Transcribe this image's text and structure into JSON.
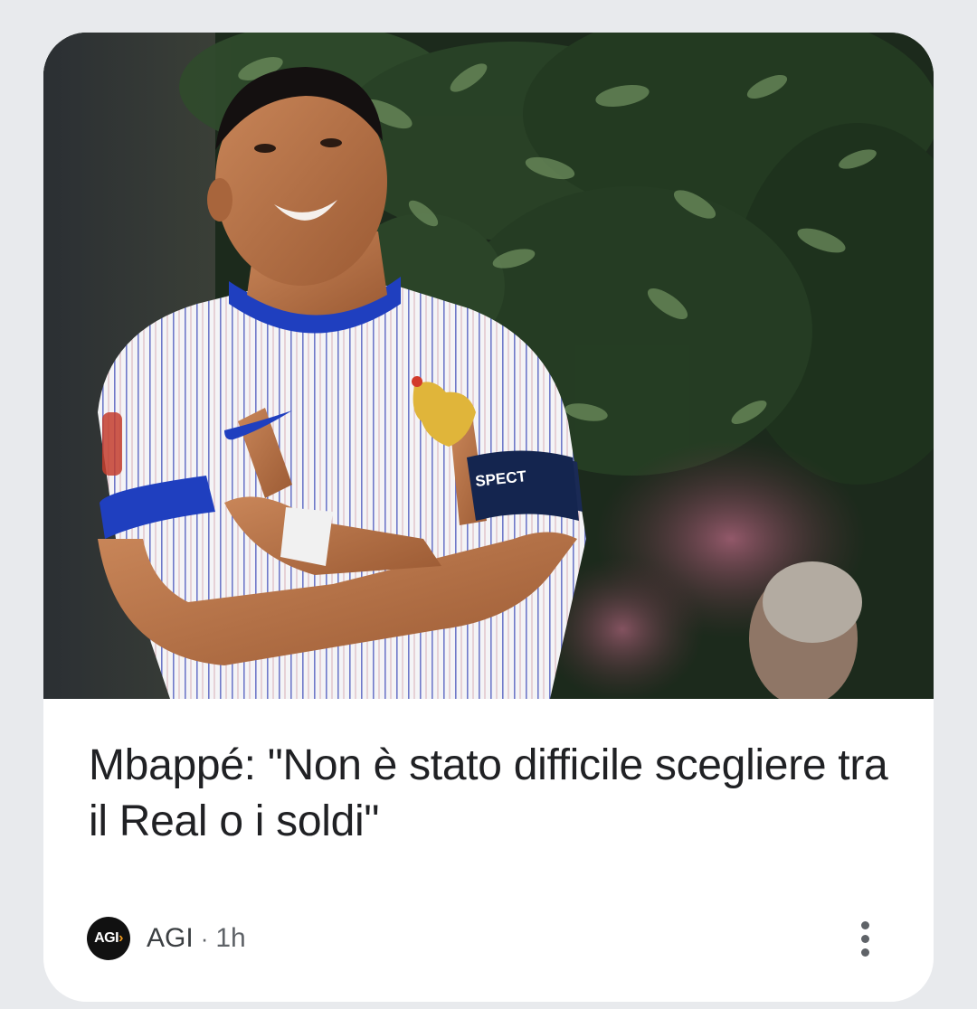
{
  "article": {
    "image_alt": "Mbappé in a white pinstriped France jersey with a captain's armband, arms crossed and pointing at the badge",
    "armband_text": "SPECT",
    "headline": "Mbappé: \"Non è stato difficile scegliere tra il Real o i soldi\"",
    "source": {
      "logo_text": "AGI",
      "logo_arrow": "›",
      "name": "AGI",
      "separator": "·",
      "time": "1h"
    },
    "more_icon": "more-vert-icon"
  },
  "colors": {
    "page_background": "#e8eaed",
    "card_background": "#ffffff",
    "headline_text": "#202124",
    "meta_text": "#5f6368",
    "jersey_blue": "#1f3fbf"
  }
}
